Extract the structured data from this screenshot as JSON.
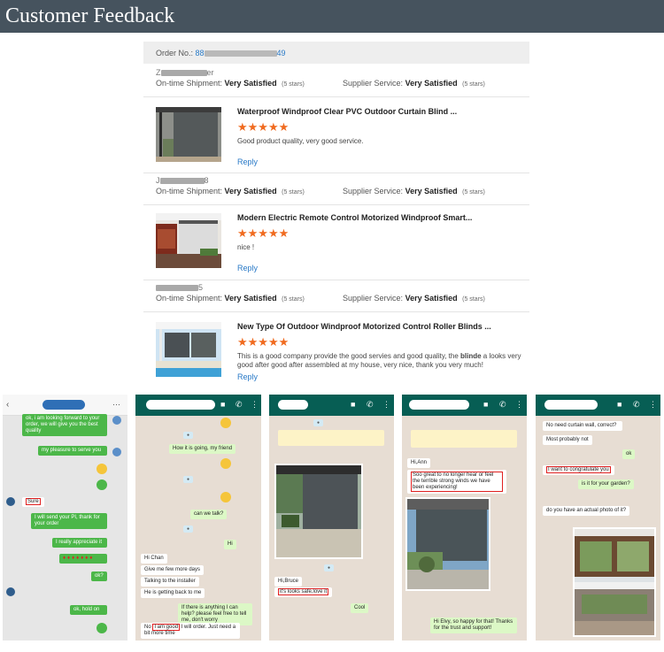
{
  "banner": {
    "title": "Customer Feedback"
  },
  "order": {
    "label": "Order No.:",
    "prefix": "88",
    "suffix": "49"
  },
  "reviews": [
    {
      "buyer_suffix": "er",
      "shipment_label": "On-time Shipment:",
      "shipment_rating": "Very Satisfied",
      "shipment_stars": "(5 stars)",
      "supplier_label": "Supplier Service:",
      "supplier_rating": "Very Satisfied",
      "supplier_stars": "(5 stars)",
      "product_title": "Waterproof Windproof Clear PVC Outdoor Curtain Blind ...",
      "stars": "★★★★★",
      "comment": "Good product quality, very good service.",
      "reply": "Reply"
    },
    {
      "buyer_prefix": "J",
      "buyer_suffix": "8",
      "shipment_label": "On-time Shipment:",
      "shipment_rating": "Very Satisfied",
      "shipment_stars": "(5 stars)",
      "supplier_label": "Supplier Service:",
      "supplier_rating": "Very Satisfied",
      "supplier_stars": "(5 stars)",
      "product_title": "Modern Electric Remote Control Motorized Windproof Smart...",
      "stars": "★★★★★",
      "comment": "nice !",
      "reply": "Reply"
    },
    {
      "buyer_suffix": "5",
      "shipment_label": "On-time Shipment:",
      "shipment_rating": "Very Satisfied",
      "shipment_stars": "(5 stars)",
      "supplier_label": "Supplier Service:",
      "supplier_rating": "Very Satisfied",
      "supplier_stars": "(5 stars)",
      "product_title": "New Type Of Outdoor Windproof Motorized Control Roller Blinds ...",
      "stars": "★★★★★",
      "comment_pre": "This is a good company provide the good servies and good quality, the ",
      "comment_bold": "blinde",
      "comment_post": " a looks very good after good after assembled at my house, very nice, thank you very much!",
      "reply": "Reply"
    }
  ],
  "chats": [
    {
      "messages": [
        "ok, i am looking forward to your order, we will give you the best quality",
        "my pleasure to serve you",
        "Sure",
        "I will send your PI, thank for your order",
        "I really appreciate it",
        "ok?",
        "ok, hold on"
      ]
    },
    {
      "messages": [
        "How it is going, my friend",
        "can we talk?",
        "Hi",
        "Hi Chan",
        "Give me few more days",
        "Talking to the installer",
        "He is getting back to me",
        "If there is anything I can help? please feel free to tell me, don't worry",
        "No",
        "I am good",
        "I will order. Just need a bit more time"
      ]
    },
    {
      "messages": [
        "Hi,Bruce",
        "it's looks safe,love it",
        "Cool"
      ]
    },
    {
      "messages": [
        "Hi,Ann",
        "Soo great to no longer hear or feel the terrible strong winds we have been experiencing!",
        "Hi Elvy, so happy for that! Thanks for the trust and support!"
      ]
    },
    {
      "messages": [
        "No need curtain wall, correct?",
        "Most probably not",
        "ok",
        "I want to congratulate you",
        "is it for your garden?",
        "do you have an actual photo of it?"
      ]
    }
  ],
  "colors": {
    "banner": "#46535e",
    "link": "#2a7ac7",
    "stars": "#f06b20",
    "whatsapp": "#075e54"
  }
}
